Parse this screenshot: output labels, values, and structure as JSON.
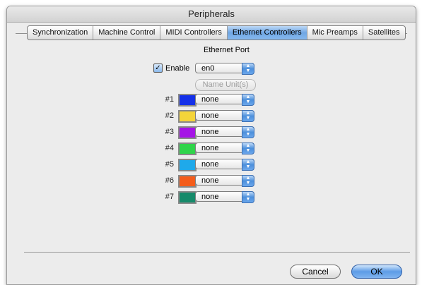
{
  "window": {
    "title": "Peripherals"
  },
  "tabs": [
    {
      "label": "Synchronization",
      "active": false
    },
    {
      "label": "Machine Control",
      "active": false
    },
    {
      "label": "MIDI Controllers",
      "active": false
    },
    {
      "label": "Ethernet Controllers",
      "active": true
    },
    {
      "label": "Mic Preamps",
      "active": false
    },
    {
      "label": "Satellites",
      "active": false
    }
  ],
  "ethernet": {
    "port_label": "Ethernet Port",
    "enable_label": "Enable",
    "enable_checked": true,
    "port_value": "en0",
    "name_units_label": "Name Unit(s)"
  },
  "units": [
    {
      "label": "#1",
      "color": "#1430e8",
      "value": "none"
    },
    {
      "label": "#2",
      "color": "#f4d43a",
      "value": "none"
    },
    {
      "label": "#3",
      "color": "#a514e6",
      "value": "none"
    },
    {
      "label": "#4",
      "color": "#2fd44a",
      "value": "none"
    },
    {
      "label": "#5",
      "color": "#1fa9ea",
      "value": "none"
    },
    {
      "label": "#6",
      "color": "#f45c1a",
      "value": "none"
    },
    {
      "label": "#7",
      "color": "#168a6a",
      "value": "none"
    }
  ],
  "buttons": {
    "cancel": "Cancel",
    "ok": "OK"
  }
}
